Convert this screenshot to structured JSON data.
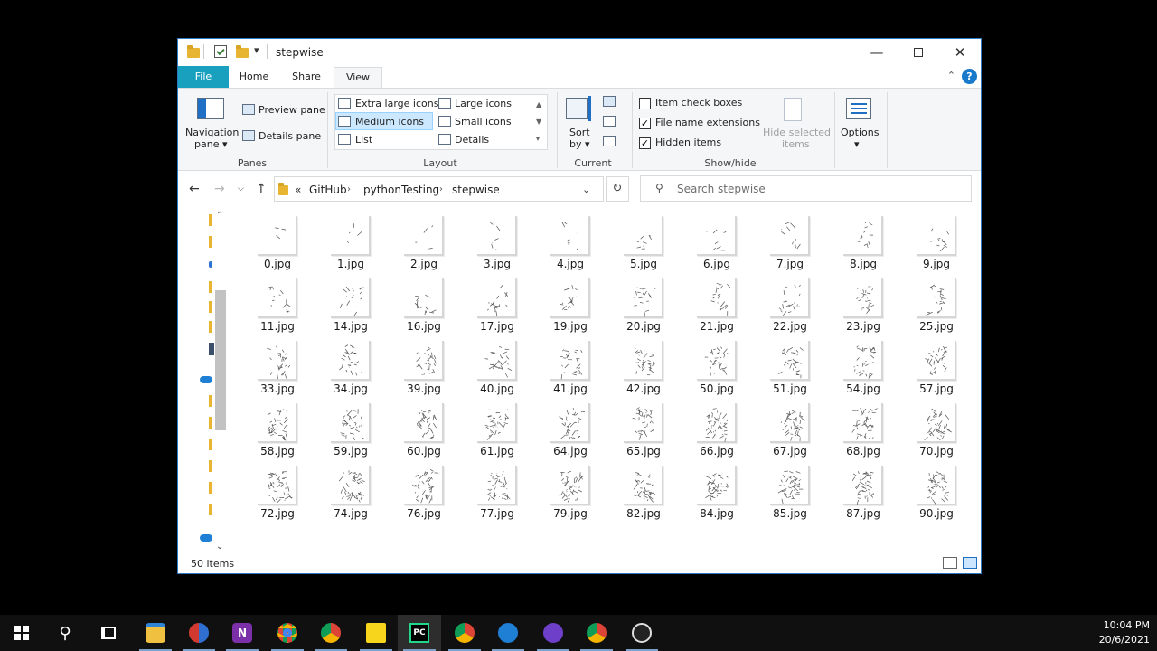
{
  "window": {
    "title": "stepwise",
    "quick_access_pin": "▾"
  },
  "ribbon_tabs": [
    {
      "label": "File"
    },
    {
      "label": "Home"
    },
    {
      "label": "Share"
    },
    {
      "label": "View"
    }
  ],
  "help_label": "?",
  "ribbon": {
    "panes": {
      "navigation_pane": "Navigation",
      "navigation_pane_2": "pane ▾",
      "preview_pane": "Preview pane",
      "details_pane": "Details pane",
      "group_label": "Panes"
    },
    "layout": {
      "extra_large_icons": "Extra large icons",
      "large_icons": "Large icons",
      "medium_icons": "Medium icons",
      "small_icons": "Small icons",
      "list": "List",
      "details": "Details",
      "group_label": "Layout"
    },
    "current_view": {
      "sort_by": "Sort",
      "sort_by_2": "by ▾",
      "group_label": "Current view"
    },
    "show_hide": {
      "item_check_boxes": "Item check boxes",
      "file_name_extensions": "File name extensions",
      "hidden_items": "Hidden items",
      "hide_selected": "Hide selected",
      "hide_selected_2": "items",
      "group_label": "Show/hide",
      "checked": {
        "item_check_boxes": false,
        "file_name_extensions": true,
        "hidden_items": true
      }
    },
    "options": {
      "label": "Options",
      "arrow": "▾"
    }
  },
  "address": {
    "overflow": "«",
    "crumbs": [
      "GitHub",
      "pythonTesting",
      "stepwise"
    ],
    "search_placeholder": "Search stepwise"
  },
  "files": [
    "0.jpg",
    "1.jpg",
    "2.jpg",
    "3.jpg",
    "4.jpg",
    "5.jpg",
    "6.jpg",
    "7.jpg",
    "8.jpg",
    "9.jpg",
    "11.jpg",
    "14.jpg",
    "16.jpg",
    "17.jpg",
    "19.jpg",
    "20.jpg",
    "21.jpg",
    "22.jpg",
    "23.jpg",
    "25.jpg",
    "33.jpg",
    "34.jpg",
    "39.jpg",
    "40.jpg",
    "41.jpg",
    "42.jpg",
    "50.jpg",
    "51.jpg",
    "54.jpg",
    "57.jpg",
    "58.jpg",
    "59.jpg",
    "60.jpg",
    "61.jpg",
    "64.jpg",
    "65.jpg",
    "66.jpg",
    "67.jpg",
    "68.jpg",
    "70.jpg",
    "72.jpg",
    "74.jpg",
    "76.jpg",
    "77.jpg",
    "79.jpg",
    "82.jpg",
    "84.jpg",
    "85.jpg",
    "87.jpg",
    "90.jpg"
  ],
  "status": {
    "item_count": "50 items"
  },
  "taskbar": {
    "apps": [
      "start",
      "search",
      "task-view",
      "file-explorer",
      "app-red-blue",
      "onenote",
      "chrome",
      "chrome",
      "sticky-notes",
      "pycharm",
      "chrome",
      "maps",
      "github-desktop",
      "chrome",
      "obs"
    ],
    "time": "10:04 PM",
    "date": "20/6/2021"
  },
  "colors": {
    "file_tab": "#19a0bf",
    "accent": "#1979ca",
    "selected_layout": "#cce8ff"
  }
}
